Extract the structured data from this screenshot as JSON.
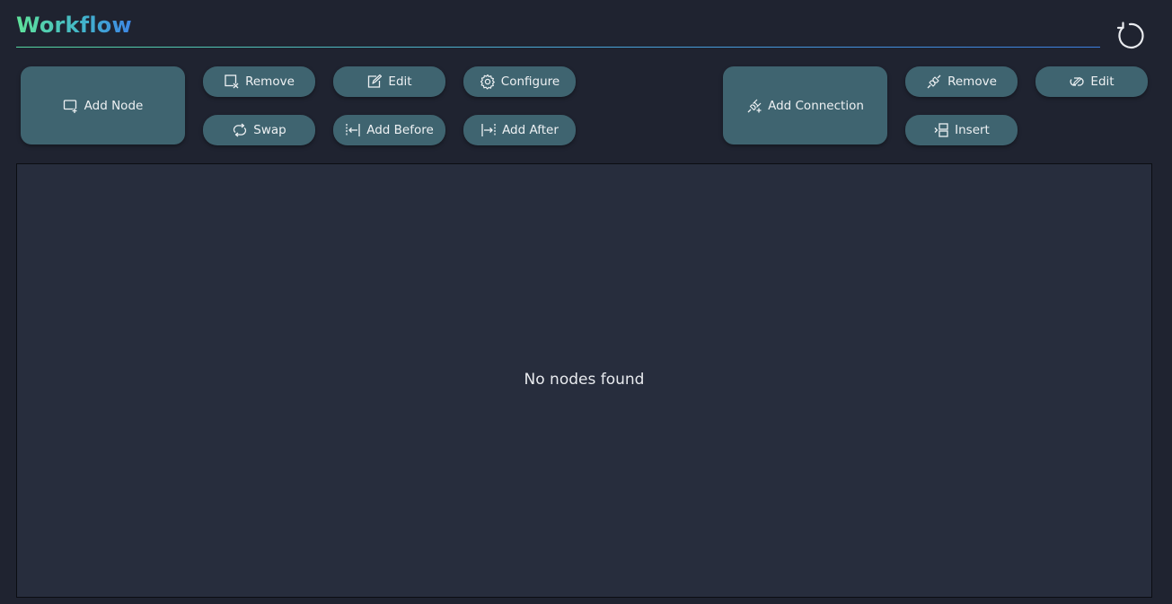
{
  "header": {
    "title": "Workflow"
  },
  "node_toolbar": {
    "add_node": "Add Node",
    "remove": "Remove",
    "edit": "Edit",
    "configure": "Configure",
    "swap": "Swap",
    "add_before": "Add Before",
    "add_after": "Add After"
  },
  "connection_toolbar": {
    "add_connection": "Add Connection",
    "remove": "Remove",
    "edit": "Edit",
    "insert": "Insert"
  },
  "canvas": {
    "empty_message": "No nodes found"
  },
  "colors": {
    "background": "#1f2330",
    "button": "#3f6470",
    "canvas": "#272d3d",
    "title_gradient_start": "#5fe39a",
    "title_gradient_end": "#3d86e6"
  },
  "icons": {
    "refresh": "refresh-icon",
    "add_node": "add-node-icon",
    "remove_node": "remove-node-icon",
    "edit_node": "edit-node-icon",
    "configure": "gear-icon",
    "swap": "swap-icon",
    "add_before": "add-before-icon",
    "add_after": "add-after-icon",
    "add_connection": "add-connection-icon",
    "remove_connection": "remove-connection-icon",
    "edit_connection": "edit-connection-icon",
    "insert": "insert-icon"
  }
}
